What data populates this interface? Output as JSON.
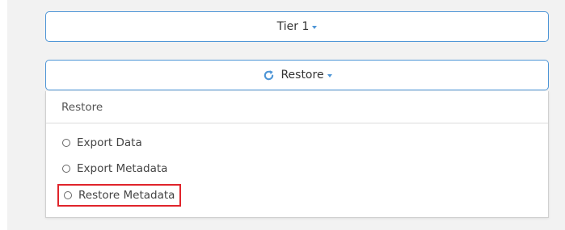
{
  "tier_dropdown": {
    "label": "Tier 1"
  },
  "restore_dropdown": {
    "label": "Restore",
    "icon": "refresh-icon"
  },
  "menu": {
    "header": "Restore",
    "items": [
      {
        "label": "Export Data",
        "icon": "radio-icon"
      },
      {
        "label": "Export Metadata",
        "icon": "radio-icon"
      },
      {
        "label": "Restore Metadata",
        "icon": "radio-icon",
        "highlighted": true
      }
    ]
  },
  "colors": {
    "accent": "#4d95d6",
    "highlight_border": "#e0242b",
    "background": "#f2f2f2"
  }
}
